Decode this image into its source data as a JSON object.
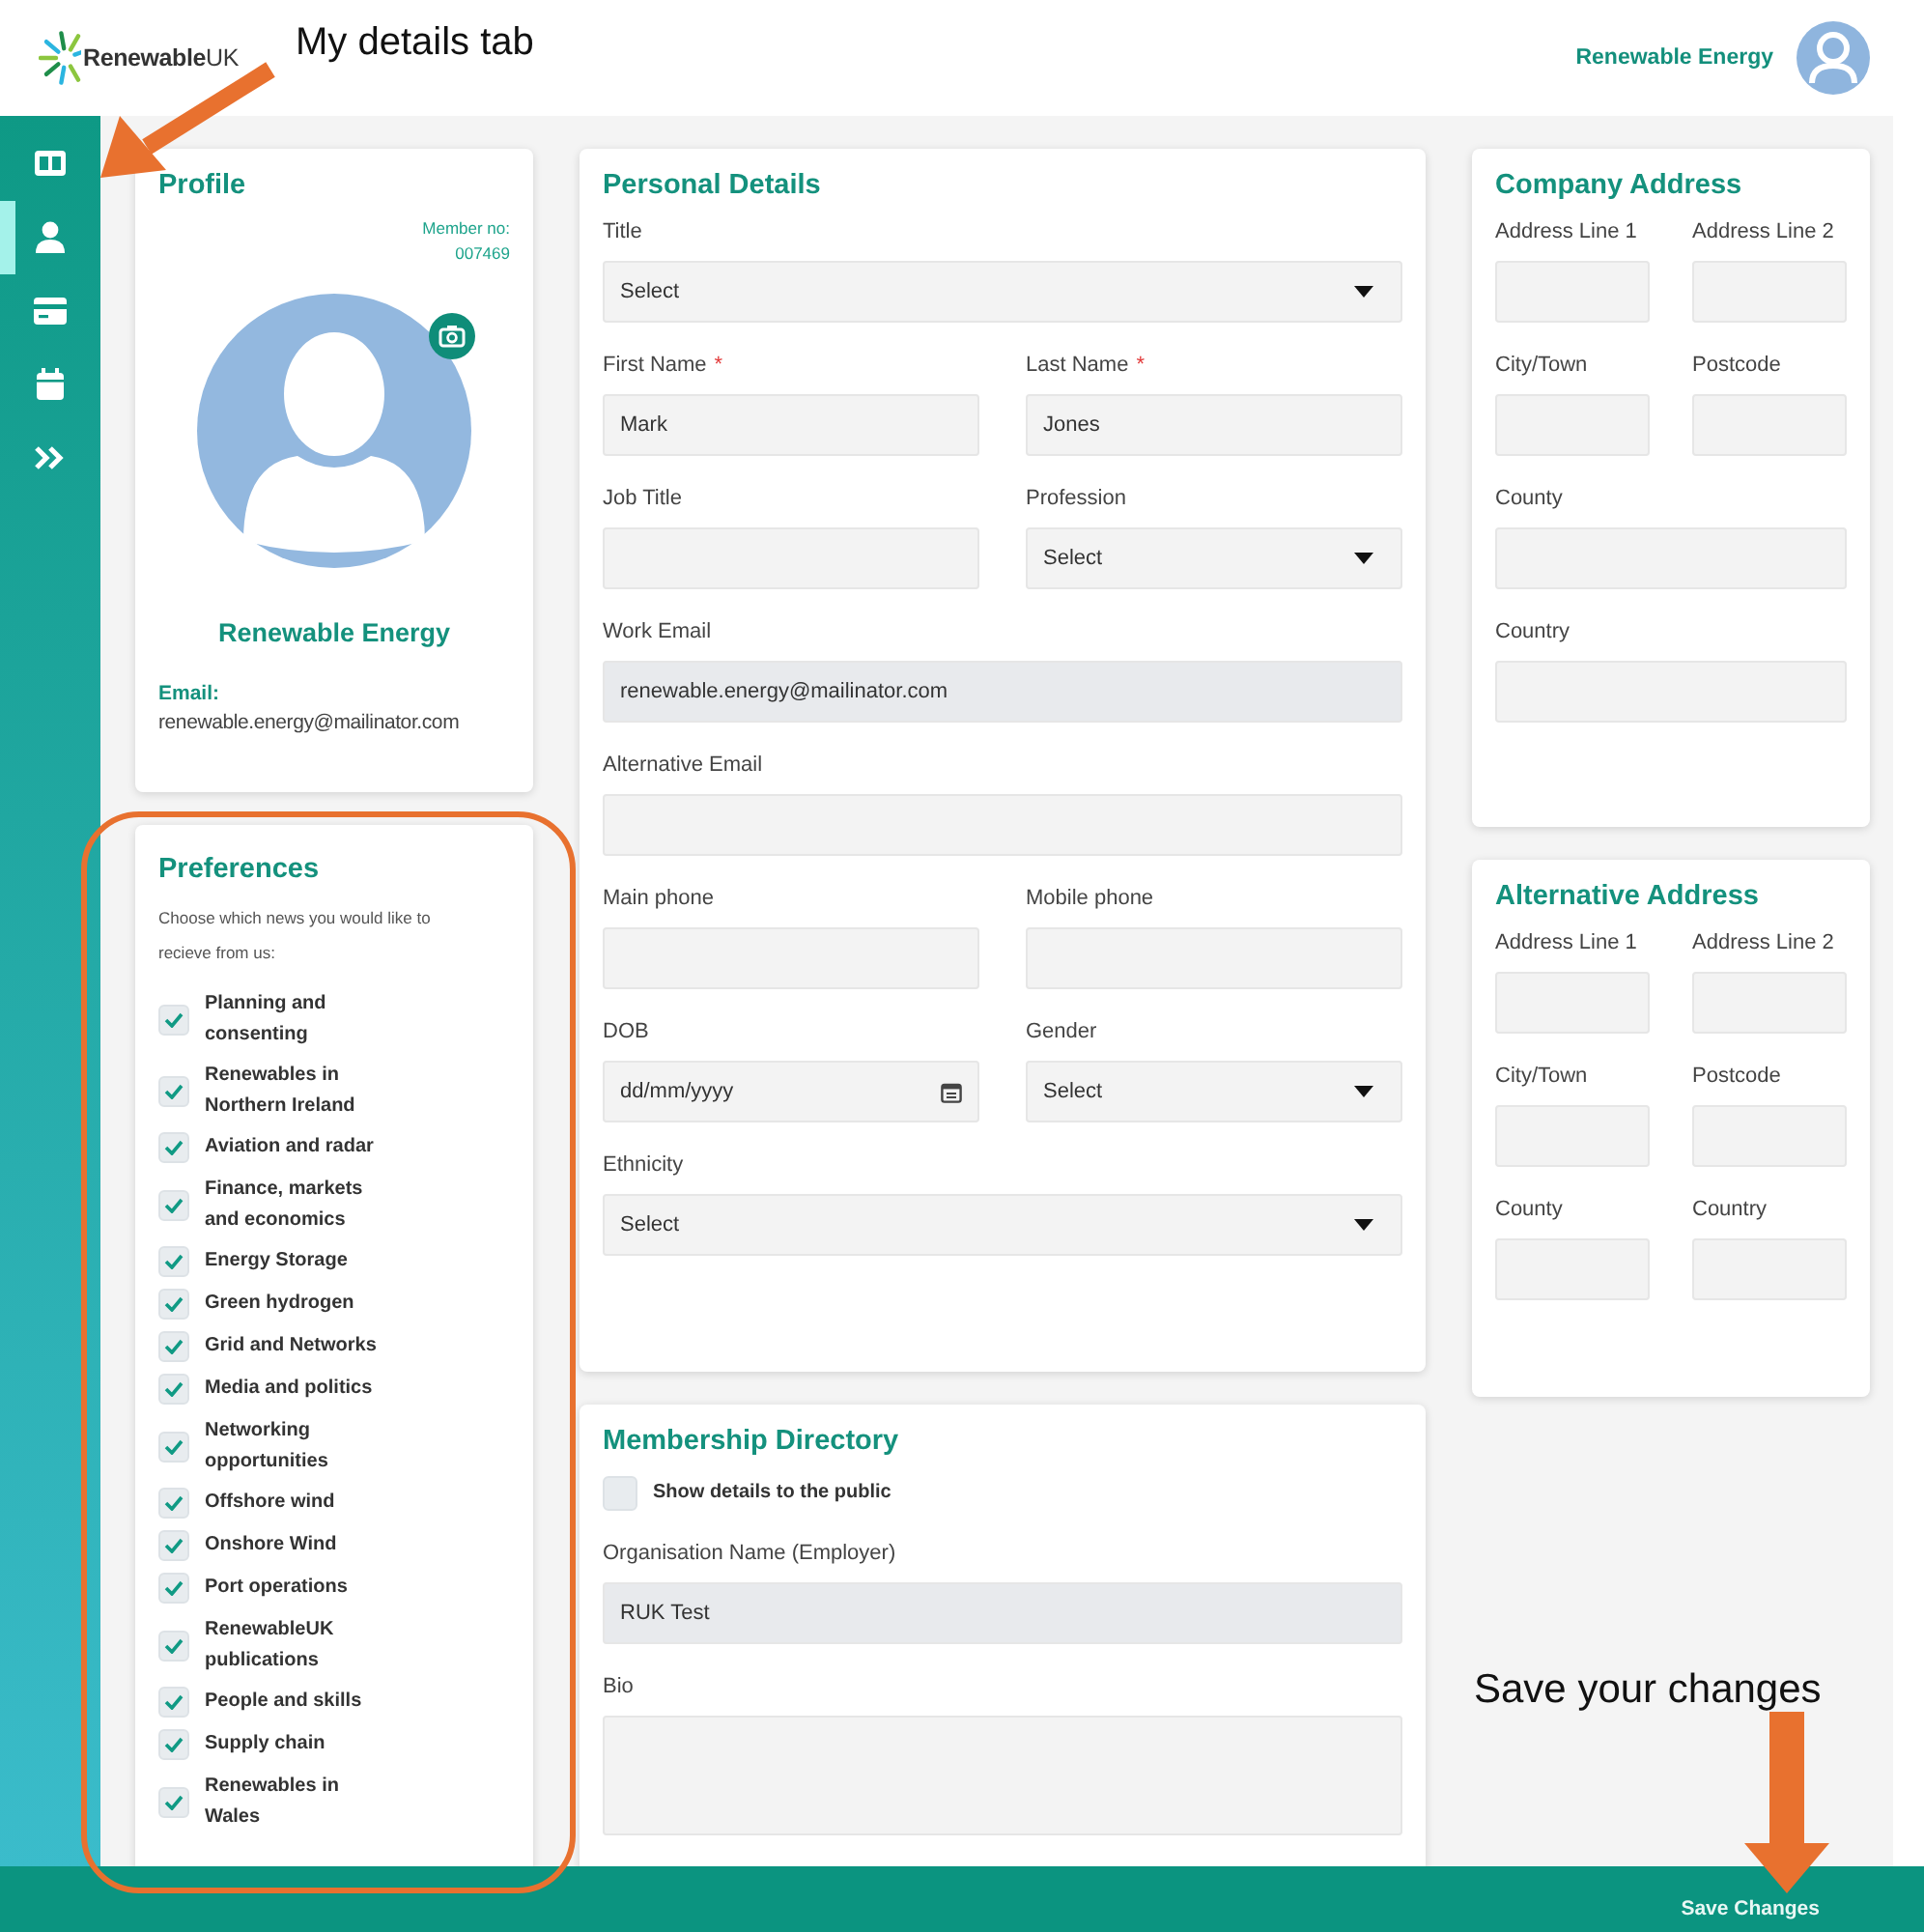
{
  "header": {
    "logo": "**Renewable**UK",
    "user_name": "Renewable Energy"
  },
  "sidebar": {
    "items": [
      {
        "kind": "dashboard",
        "selected": false
      },
      {
        "kind": "profile",
        "selected": true
      },
      {
        "kind": "card",
        "selected": false
      },
      {
        "kind": "calendar",
        "selected": false
      },
      {
        "kind": "expand",
        "selected": false
      }
    ]
  },
  "profile": {
    "title": "Profile",
    "member_label": "Member no:",
    "member_no": "007469",
    "name": "Renewable Energy",
    "email_label": "Email:",
    "email": "renewable.energy@mailinator.com"
  },
  "preferences": {
    "title": "Preferences",
    "intro": "Choose which news you would like to recieve from us:",
    "options": [
      {
        "label": "Planning and consenting",
        "checked": true
      },
      {
        "label": "Renewables in Northern Ireland",
        "checked": true
      },
      {
        "label": "Aviation and radar",
        "checked": true
      },
      {
        "label": "Finance, markets and economics",
        "checked": true
      },
      {
        "label": "Energy Storage",
        "checked": true
      },
      {
        "label": "Green hydrogen",
        "checked": true
      },
      {
        "label": "Grid and Networks",
        "checked": true
      },
      {
        "label": "Media and politics",
        "checked": true
      },
      {
        "label": "Networking opportunities",
        "checked": true
      },
      {
        "label": "Offshore wind",
        "checked": true
      },
      {
        "label": "Onshore Wind",
        "checked": true
      },
      {
        "label": "Port operations",
        "checked": true
      },
      {
        "label": "RenewableUK publications",
        "checked": true
      },
      {
        "label": "People and skills",
        "checked": true
      },
      {
        "label": "Supply chain",
        "checked": true
      },
      {
        "label": "Renewables in Wales",
        "checked": true
      }
    ]
  },
  "personal_details": {
    "title": "Personal Details",
    "rows": [
      [
        {
          "label": "Title",
          "kind": "select",
          "value": "Select"
        }
      ],
      [
        {
          "label": "First Name",
          "required_mark": "*",
          "kind": "text",
          "value": "Mark"
        },
        {
          "label": "Last Name",
          "required_mark": "*",
          "kind": "text",
          "value": "Jones"
        }
      ],
      [
        {
          "label": "Job Title",
          "kind": "text"
        },
        {
          "label": "Profession",
          "kind": "select",
          "value": "Select"
        }
      ],
      [
        {
          "label": "Work Email",
          "kind": "text",
          "value": "renewable.energy@mailinator.com",
          "disabled": true
        }
      ],
      [
        {
          "label": "Alternative Email",
          "kind": "text"
        }
      ],
      [
        {
          "label": "Main phone",
          "kind": "text"
        },
        {
          "label": "Mobile phone",
          "kind": "text"
        }
      ],
      [
        {
          "label": "DOB",
          "kind": "date",
          "placeholder": "dd/mm/yyyy"
        },
        {
          "label": "Gender",
          "kind": "select",
          "value": "Select"
        }
      ],
      [
        {
          "label": "Ethnicity",
          "kind": "select",
          "value": "Select"
        }
      ]
    ]
  },
  "membership_directory": {
    "title": "Membership Directory",
    "public_option": {
      "label": "Show details to the public",
      "checked": false
    },
    "rows": [
      [
        {
          "label": "Organisation Name (Employer)",
          "kind": "text",
          "value": "RUK Test",
          "disabled": true
        }
      ],
      [
        {
          "label": "Bio",
          "kind": "textarea"
        }
      ]
    ]
  },
  "company_address": {
    "title": "Company Address",
    "rows": [
      [
        {
          "label": "Address Line 1",
          "kind": "text"
        },
        {
          "label": "Address Line 2",
          "kind": "text"
        }
      ],
      [
        {
          "label": "City/Town",
          "kind": "text"
        },
        {
          "label": "Postcode",
          "kind": "text"
        }
      ],
      [
        {
          "label": "County",
          "kind": "text"
        }
      ],
      [
        {
          "label": "Country",
          "kind": "text"
        }
      ]
    ]
  },
  "alternative_address": {
    "title": "Alternative Address",
    "rows": [
      [
        {
          "label": "Address Line 1",
          "kind": "text"
        },
        {
          "label": "Address Line 2",
          "kind": "text"
        }
      ],
      [
        {
          "label": "City/Town",
          "kind": "text"
        },
        {
          "label": "Postcode",
          "kind": "text"
        }
      ],
      [
        {
          "label": "County",
          "kind": "text"
        },
        {
          "label": "Country",
          "kind": "text"
        }
      ]
    ]
  },
  "footer": {
    "save_button": "Save Changes"
  },
  "annotations": [
    {
      "kind": "label",
      "text": "My details tab"
    },
    {
      "kind": "arrow"
    },
    {
      "kind": "outline"
    },
    {
      "kind": "label",
      "text": "Save your changes"
    },
    {
      "kind": "arrow"
    }
  ]
}
